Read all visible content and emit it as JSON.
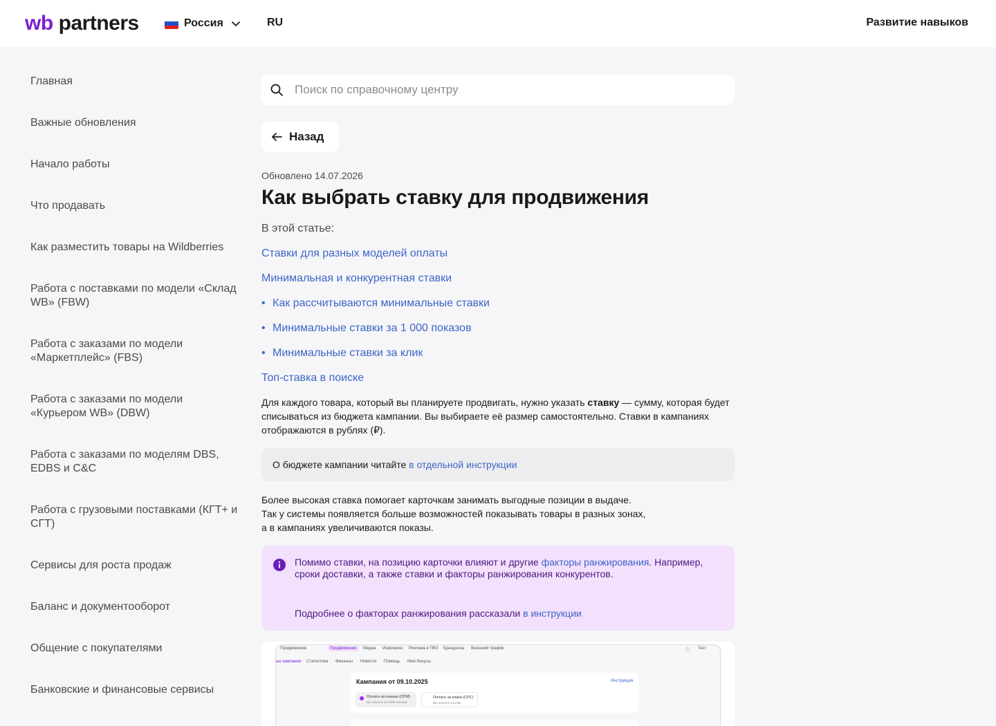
{
  "header": {
    "logo_wb": "wb",
    "logo_partners": "partners",
    "country": "Россия",
    "language": "RU",
    "skills_link": "Развитие навыков",
    "flag_colors": [
      "#ffffff",
      "#1e50c8",
      "#e02020"
    ]
  },
  "sidebar": {
    "items": [
      {
        "label": "Главная"
      },
      {
        "label": "Важные обновления"
      },
      {
        "label": "Начало работы"
      },
      {
        "label": "Что продавать"
      },
      {
        "label": "Как разместить товары на Wildberries"
      },
      {
        "label": "Работа с поставками по модели «Склад WB» (FBW)"
      },
      {
        "label": "Работа с заказами по модели «Маркетплейс» (FBS)"
      },
      {
        "label": "Работа с заказами по модели «Курьером WB» (DBW)"
      },
      {
        "label": "Работа с заказами по моделям DBS, EDBS и C&C"
      },
      {
        "label": "Работа с грузовыми поставками (КГТ+ и СГТ)"
      },
      {
        "label": "Сервисы для роста продаж"
      },
      {
        "label": "Баланс и документооборот"
      },
      {
        "label": "Общение с покупателями"
      },
      {
        "label": "Банковские и финансовые сервисы"
      }
    ]
  },
  "search": {
    "placeholder": "Поиск по справочному центру",
    "value": ""
  },
  "article": {
    "back_label": "Назад",
    "updated": "Обновлено 14.07.2026",
    "title": "Как выбрать ставку для продвижения",
    "toc_label": "В этой статье:",
    "toc": [
      {
        "label": "Ставки для разных моделей оплаты",
        "sub": false
      },
      {
        "label": "Минимальная и конкурентная ставки",
        "sub": false
      },
      {
        "label": "Как рассчитываются минимальные ставки",
        "sub": true
      },
      {
        "label": "Минимальные ставки за 1 000 показов",
        "sub": true
      },
      {
        "label": "Минимальные ставки за клик",
        "sub": true
      },
      {
        "label": "Топ-ставка в поиске",
        "sub": false
      }
    ],
    "para1_a": "Для каждого товара, который вы планируете продвигать, нужно указать ",
    "para1_bold": "ставку",
    "para1_b": " — сумму, которая будет списываться из бюджета кампании. Вы выбираете её размер самостоятельно. Ставки в кампаниях отображаются в рублях (₽).",
    "note_text": "О бюджете кампании читайте ",
    "note_link": "в отдельной инструкции",
    "para2_l1": "Более высокая ставка помогает карточкам занимать выгодные позиции в выдаче.",
    "para2_l2": "Так у системы появляется больше возможностей показывать товары в разных зонах,",
    "para2_l3": "а в кампаниях увеличиваются показы.",
    "info_a": "Помимо ставки, на позицию карточки влияют и другие ",
    "info_link1": "факторы ранжирования",
    "info_b": ". Например, сроки доставки, а также ставки и факторы ранжирования конкурентов.",
    "info_c": "Подробнее о факторах ранжирования рассказали ",
    "info_link2": "в инструкции"
  },
  "screenshot": {
    "nav_top": [
      "Продвижение",
      "Продвижение",
      "Медиа",
      "Инфлюенс",
      "Реклама в ПВЗ",
      "Брендзона",
      "Внешний трафик"
    ],
    "user": "Тест",
    "nav_second": [
      "ые кампании",
      "Статистика",
      "Финансы",
      "Новости",
      "Помощь",
      "Мои бонусы"
    ],
    "campaign_title": "Кампания от 09.10.2025",
    "instruction": "Инструкция",
    "opt1_title": "Оплата за показы (CPM)",
    "opt1_sub": "Вы платите за 1000 показов",
    "opt2_title": "Оплата за клики (CPC)",
    "opt2_sub": "Вы платите за клик"
  },
  "colors": {
    "brand": "#7b1fd1",
    "link": "#3d65c4",
    "info_bg": "#f3e0fd",
    "info_text": "#4b1a80"
  }
}
